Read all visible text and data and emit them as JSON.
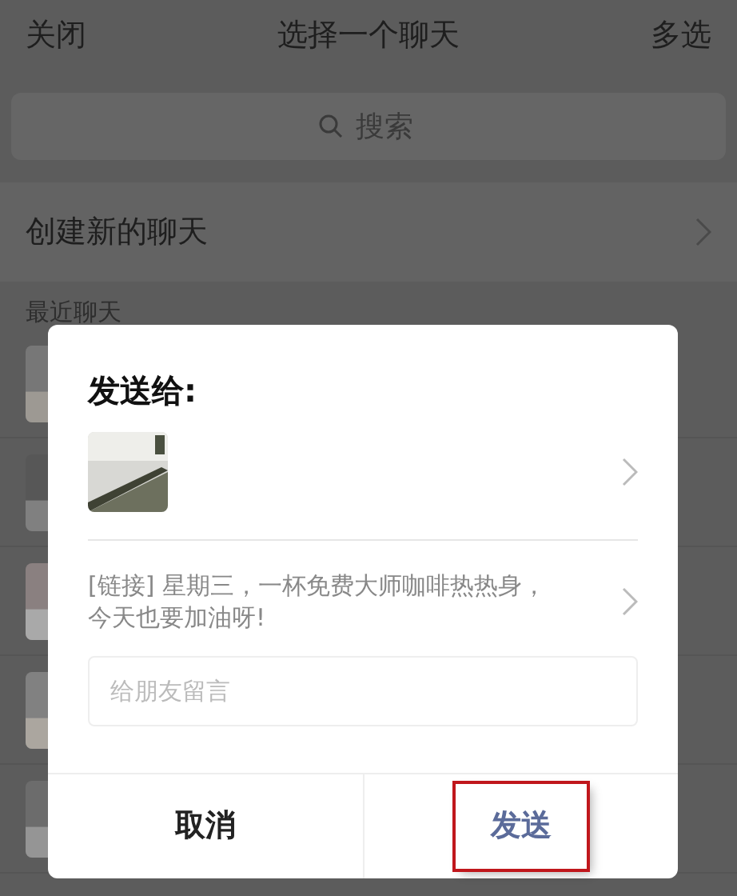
{
  "header": {
    "left": "关闭",
    "title": "选择一个聊天",
    "right": "多选"
  },
  "search": {
    "placeholder": "搜索"
  },
  "create_chat": {
    "label": "创建新的聊天"
  },
  "section_header": "最近聊天",
  "dialog": {
    "title": "发送给:",
    "message": "[链接] 星期三，一杯免费大师咖啡热热身，今天也要加油呀!",
    "comment": {
      "placeholder": "给朋友留言"
    },
    "buttons": [
      {
        "label": "取消",
        "kind": "cancel",
        "highlighted": false
      },
      {
        "label": "发送",
        "kind": "send",
        "highlighted": true
      }
    ]
  }
}
